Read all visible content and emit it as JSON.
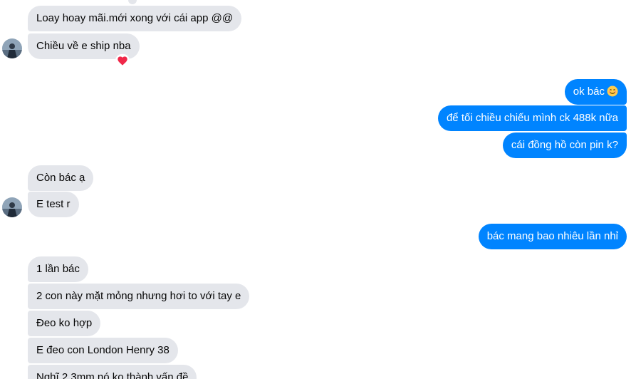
{
  "conversation": {
    "incoming_1": [
      {
        "text": "Loay hoay mãi.mới xong với cái app @@"
      },
      {
        "text": "Chiều về e ship nba",
        "reaction": "heart-icon"
      }
    ],
    "outgoing_1": [
      {
        "text": "ok bác",
        "emoji": "smiling-face-icon"
      },
      {
        "text": "để tối chiều chiếu mình ck 488k nữa"
      },
      {
        "text": "cái đồng hồ còn pin k?"
      }
    ],
    "incoming_2": [
      {
        "text": "Còn bác ạ"
      },
      {
        "text": "E test r"
      }
    ],
    "outgoing_2": [
      {
        "text": "bác mang bao nhiêu lần nhỉ"
      }
    ],
    "incoming_3": [
      {
        "text": "1 lần bác"
      },
      {
        "text": "2 con này mặt mỏng nhưng hơi to với tay e"
      },
      {
        "text": "Đeo ko hợp"
      },
      {
        "text": "E đeo con London Henry 38"
      },
      {
        "text": "Nghĩ 2.3mm nó ko thành vấn đề"
      }
    ]
  },
  "colors": {
    "incoming_bubble": "#e4e6eb",
    "outgoing_bubble": "#0084ff",
    "outgoing_text": "#ffffff",
    "incoming_text": "#050505",
    "reaction_heart": "#f02849"
  }
}
